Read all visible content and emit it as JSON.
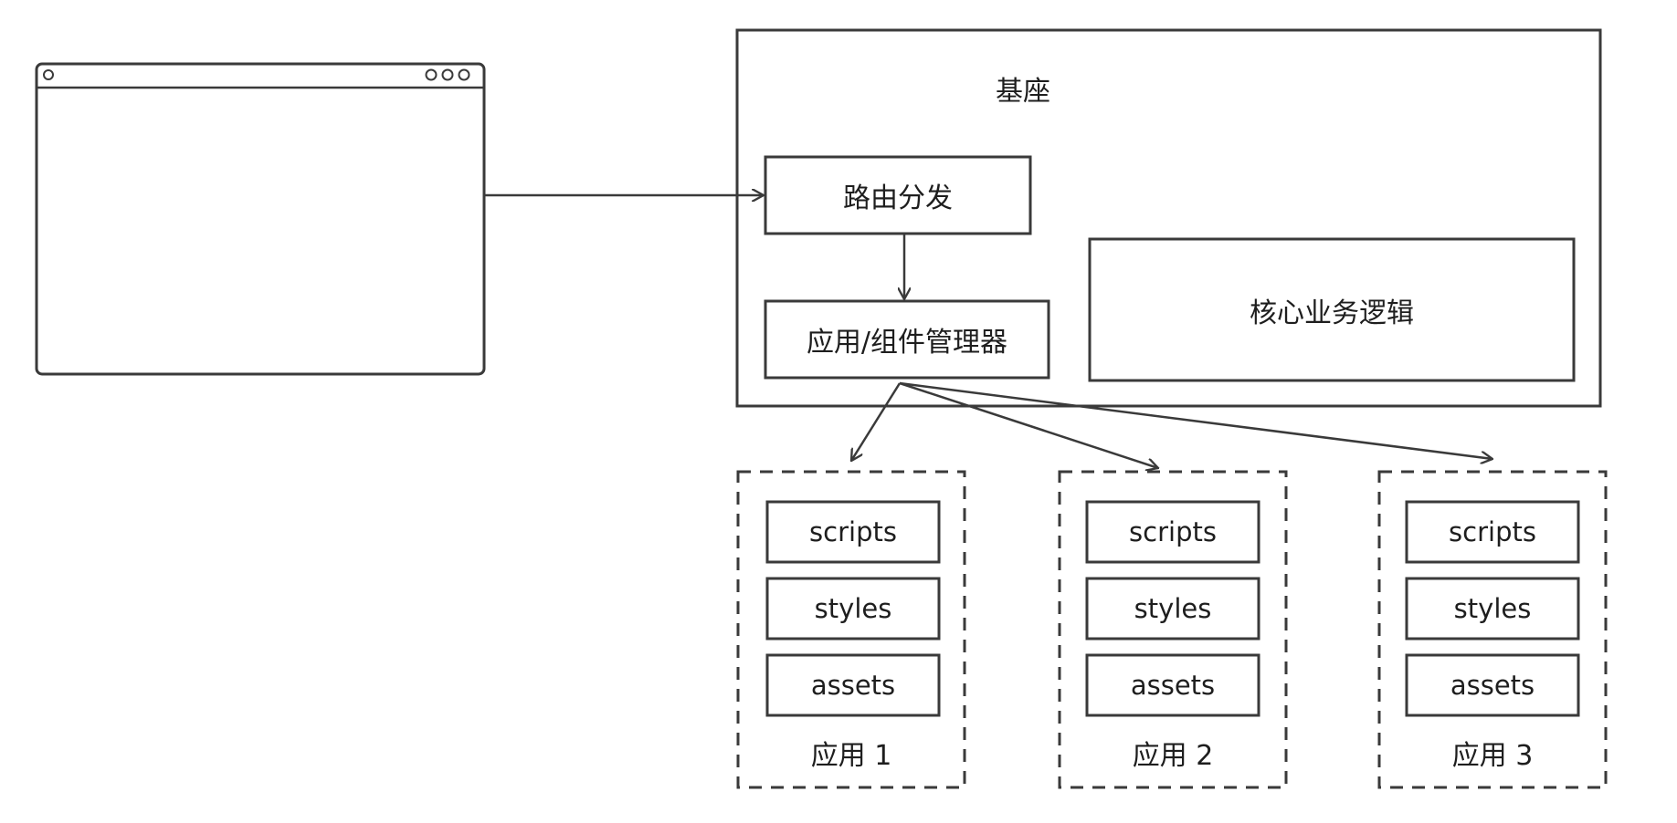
{
  "base": {
    "title": "基座",
    "router": "路由分发",
    "manager": "应用/组件管理器",
    "core": "核心业务逻辑"
  },
  "apps": [
    {
      "label": "应用 1",
      "resources": [
        "scripts",
        "styles",
        "assets"
      ]
    },
    {
      "label": "应用 2",
      "resources": [
        "scripts",
        "styles",
        "assets"
      ]
    },
    {
      "label": "应用 3",
      "resources": [
        "scripts",
        "styles",
        "assets"
      ]
    }
  ],
  "colors": {
    "stroke": "#3a3a3a",
    "text": "#1e1e1e",
    "background": "#ffffff"
  }
}
